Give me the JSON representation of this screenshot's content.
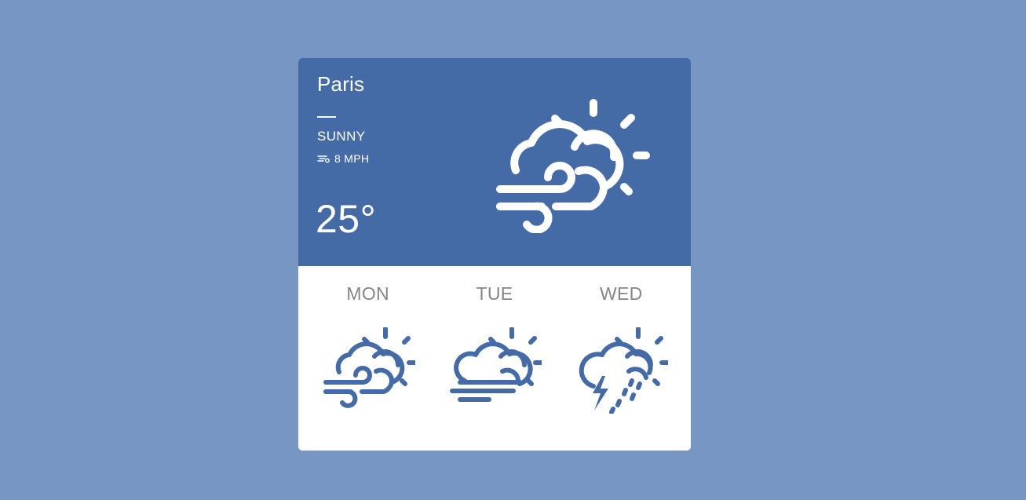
{
  "current": {
    "city": "Paris",
    "condition": "SUNNY",
    "wind": "8 MPH",
    "temperature": "25°",
    "icon": "wind-cloud-sun-icon"
  },
  "forecast": [
    {
      "day": "MON",
      "icon": "wind-cloud-sun-icon"
    },
    {
      "day": "TUE",
      "icon": "fog-cloud-sun-icon"
    },
    {
      "day": "WED",
      "icon": "storm-cloud-sun-icon"
    }
  ],
  "colors": {
    "page_background": "#7796c3",
    "header_background": "#446ba6",
    "icon_blue": "#446ba6",
    "day_label": "#858585",
    "white": "#ffffff"
  }
}
